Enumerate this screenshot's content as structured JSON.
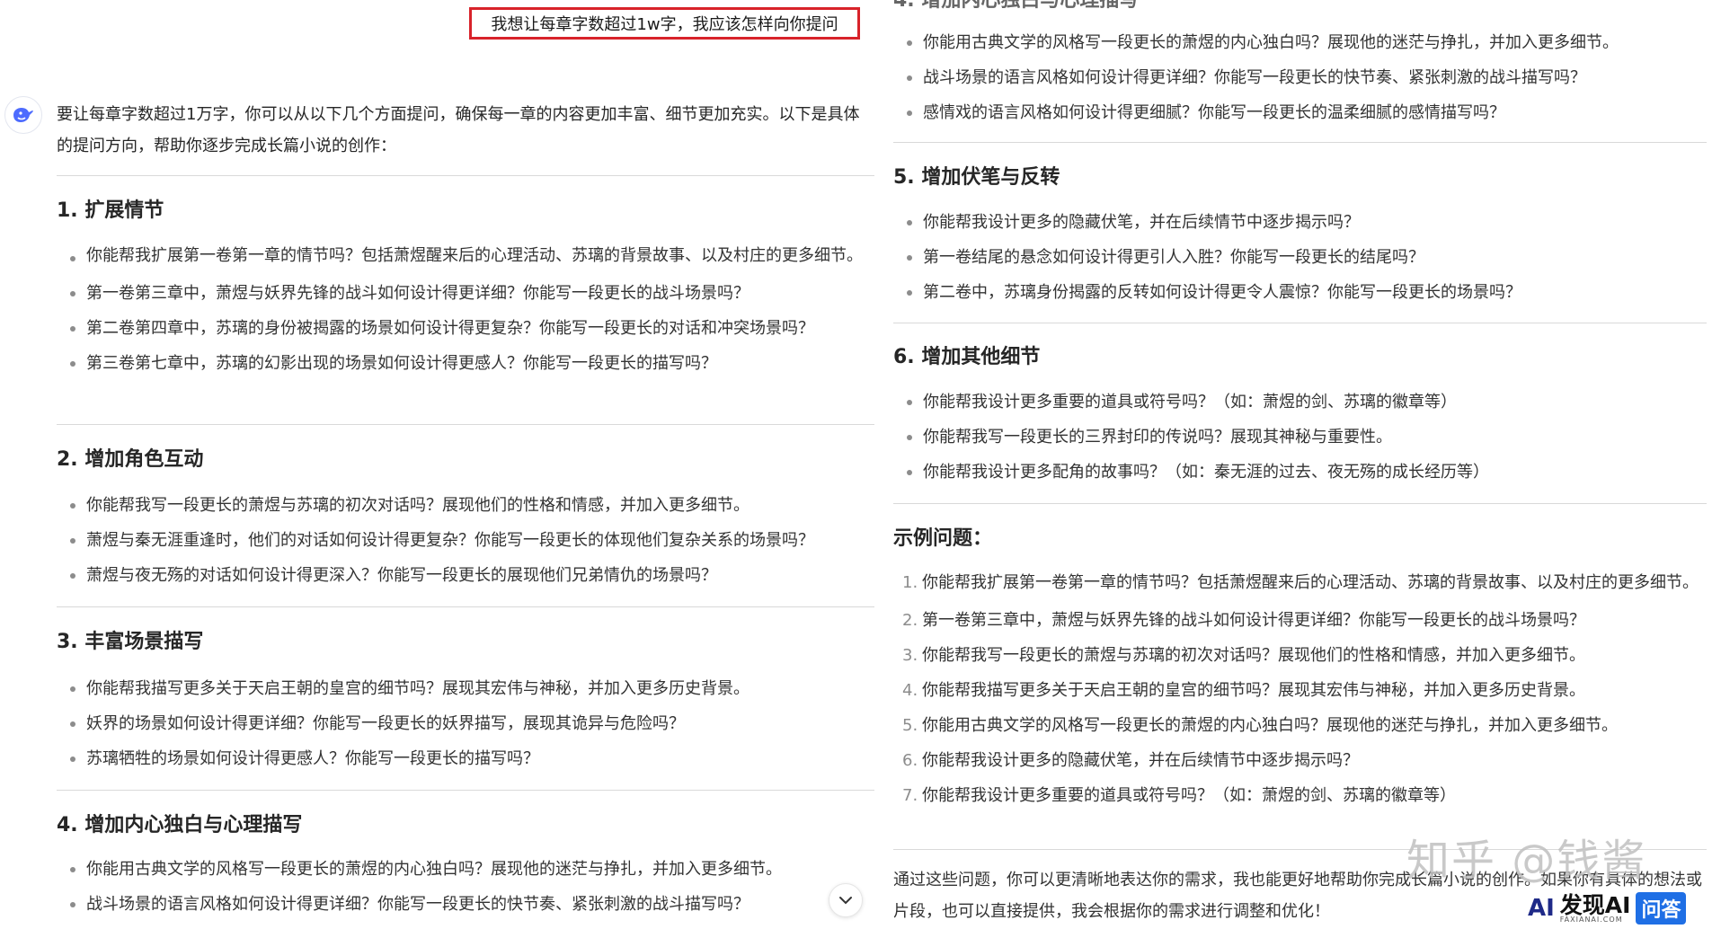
{
  "user_message": "我想让每章字数超过1w字，我应该怎样向你提问",
  "intro": "要让每章字数超过1万字，你可以从以下几个方面提问，确保每一章的内容更加丰富、细节更加充实。以下是具体的提问方向，帮助你逐步完成长篇小说的创作：",
  "sections": [
    {
      "title": "1. 扩展情节",
      "items": [
        "你能帮我扩展第一卷第一章的情节吗？包括萧煜醒来后的心理活动、苏璃的背景故事、以及村庄的更多细节。",
        "第一卷第三章中，萧煜与妖界先锋的战斗如何设计得更详细？你能写一段更长的战斗场景吗？",
        "第二卷第四章中，苏璃的身份被揭露的场景如何设计得更复杂？你能写一段更长的对话和冲突场景吗？",
        "第三卷第七章中，苏璃的幻影出现的场景如何设计得更感人？你能写一段更长的描写吗？"
      ]
    },
    {
      "title": "2. 增加角色互动",
      "items": [
        "你能帮我写一段更长的萧煜与苏璃的初次对话吗？展现他们的性格和情感，并加入更多细节。",
        "萧煜与秦无涯重逢时，他们的对话如何设计得更复杂？你能写一段更长的体现他们复杂关系的场景吗？",
        "萧煜与夜无殇的对话如何设计得更深入？你能写一段更长的展现他们兄弟情仇的场景吗？"
      ]
    },
    {
      "title": "3. 丰富场景描写",
      "items": [
        "你能帮我描写更多关于天启王朝的皇宫的细节吗？展现其宏伟与神秘，并加入更多历史背景。",
        "妖界的场景如何设计得更详细？你能写一段更长的妖界描写，展现其诡异与危险吗？",
        "苏璃牺牲的场景如何设计得更感人？你能写一段更长的描写吗？"
      ]
    },
    {
      "title": "4. 增加内心独白与心理描写",
      "items": [
        "你能用古典文学的风格写一段更长的萧煜的内心独白吗？展现他的迷茫与挣扎，并加入更多细节。",
        "战斗场景的语言风格如何设计得更详细？你能写一段更长的快节奏、紧张刺激的战斗描写吗？",
        "感情戏的语言风格如何设计得更细腻？你能写一段更长的温柔细腻的感情描写吗？"
      ]
    },
    {
      "title": "5. 增加伏笔与反转",
      "items": [
        "你能帮我设计更多的隐藏伏笔，并在后续情节中逐步揭示吗？",
        "第一卷结尾的悬念如何设计得更引人入胜？你能写一段更长的结尾吗？",
        "第二卷中，苏璃身份揭露的反转如何设计得更令人震惊？你能写一段更长的场景吗？"
      ]
    },
    {
      "title": "6. 增加其他细节",
      "items": [
        "你能帮我设计更多重要的道具或符号吗？（如：萧煜的剑、苏璃的徽章等）",
        "你能帮我写一段更长的三界封印的传说吗？展现其神秘与重要性。",
        "你能帮我设计更多配角的故事吗？（如：秦无涯的过去、夜无殇的成长经历等）"
      ]
    }
  ],
  "examples": {
    "title": "示例问题：",
    "items": [
      "你能帮我扩展第一卷第一章的情节吗？包括萧煜醒来后的心理活动、苏璃的背景故事、以及村庄的更多细节。",
      "第一卷第三章中，萧煜与妖界先锋的战斗如何设计得更详细？你能写一段更长的战斗场景吗？",
      "你能帮我写一段更长的萧煜与苏璃的初次对话吗？展现他们的性格和情感，并加入更多细节。",
      "你能帮我描写更多关于天启王朝的皇宫的细节吗？展现其宏伟与神秘，并加入更多历史背景。",
      "你能用古典文学的风格写一段更长的萧煜的内心独白吗？展现他的迷茫与挣扎，并加入更多细节。",
      "你能帮我设计更多的隐藏伏笔，并在后续情节中逐步揭示吗？",
      "你能帮我设计更多重要的道具或符号吗？（如：萧煜的剑、苏璃的徽章等）"
    ],
    "numbers": [
      "1.",
      "2.",
      "3.",
      "4.",
      "5.",
      "6.",
      "7."
    ]
  },
  "closing": "通过这些问题，你可以更清晰地表达你的需求，我也能更好地帮助你完成长篇小说的创作。如果你有具体的想法或片段，也可以直接提供，我会根据你的需求进行调整和优化！",
  "watermark": "知乎 @钱酱",
  "badge": {
    "logo_ai": "AI",
    "name": "发现AI",
    "domain": "FAXIANAI.COM",
    "qa": "问答"
  },
  "colors": {
    "user_border": "#d8232a",
    "badge_blue": "#1f6fe5",
    "logo_blue": "#1f2a88"
  },
  "icons": {
    "assistant_avatar": "whale-logo-icon",
    "scroll_down": "chevron-down-icon"
  }
}
